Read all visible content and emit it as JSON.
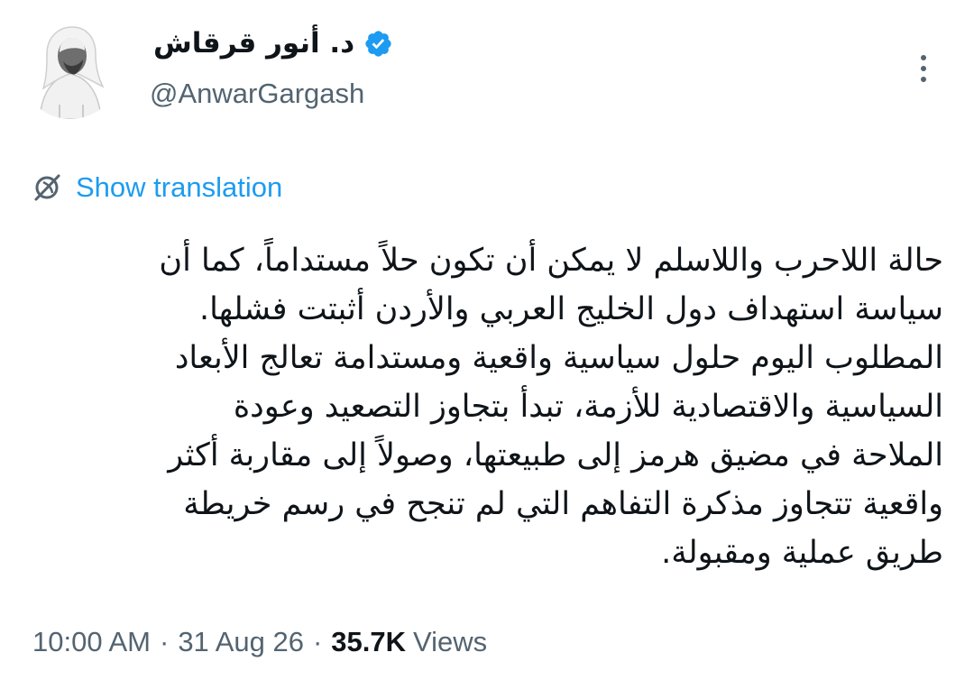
{
  "author": {
    "display_name": "د. أنور قرقاش",
    "handle": "@AnwarGargash",
    "verified": true,
    "verified_color": "#1d9bf0"
  },
  "actions": {
    "more_icon": "more-vertical-icon"
  },
  "translation": {
    "icon": "translate-globe-icon",
    "label": "Show translation"
  },
  "tweet": {
    "lines": [
      "حالة اللاحرب واللاسلم لا يمكن أن تكون حلاً مستداماً، كما أن",
      "سياسة استهداف دول الخليج العربي والأردن أثبتت فشلها.",
      "المطلوب اليوم حلول سياسية واقعية ومستدامة تعالج الأبعاد",
      "السياسية والاقتصادية للأزمة، تبدأ بتجاوز التصعيد وعودة",
      "الملاحة في مضيق هرمز إلى طبيعتها، وصولاً إلى مقاربة أكثر",
      "واقعية تتجاوز مذكرة التفاهم التي لم تنجح في رسم خريطة",
      "طريق عملية ومقبولة."
    ]
  },
  "meta": {
    "time": "10:00 AM",
    "separator": "·",
    "date": "31 Aug 26",
    "views_count": "35.7K",
    "views_label": "Views"
  },
  "colors": {
    "text": "#0f1419",
    "secondary": "#536471",
    "link": "#1d9bf0"
  }
}
